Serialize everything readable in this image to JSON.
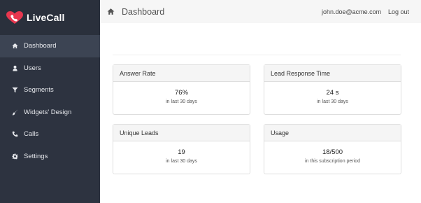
{
  "app": {
    "name": "LiveCall"
  },
  "sidebar": {
    "items": [
      {
        "label": "Dashboard",
        "icon": "home-icon",
        "active": true
      },
      {
        "label": "Users",
        "icon": "user-icon",
        "active": false
      },
      {
        "label": "Segments",
        "icon": "filter-icon",
        "active": false
      },
      {
        "label": "Widgets' Design",
        "icon": "brush-icon",
        "active": false
      },
      {
        "label": "Calls",
        "icon": "phone-icon",
        "active": false
      },
      {
        "label": "Settings",
        "icon": "gear-icon",
        "active": false
      }
    ]
  },
  "header": {
    "title": "Dashboard",
    "user_email": "john.doe@acme.com",
    "logout_label": "Log out"
  },
  "cards": [
    {
      "title": "Answer Rate",
      "value": "76%",
      "sub": "in last 30 days"
    },
    {
      "title": "Lead Response Time",
      "value": "24 s",
      "sub": "in last 30 days"
    },
    {
      "title": "Unique Leads",
      "value": "19",
      "sub": "in last 30 days"
    },
    {
      "title": "Usage",
      "value": "18/500",
      "sub": "in this subscription period"
    }
  ],
  "colors": {
    "sidebar_bg": "#2d3340",
    "active_item_bg": "#3c4453",
    "brand_red": "#e8374f"
  }
}
